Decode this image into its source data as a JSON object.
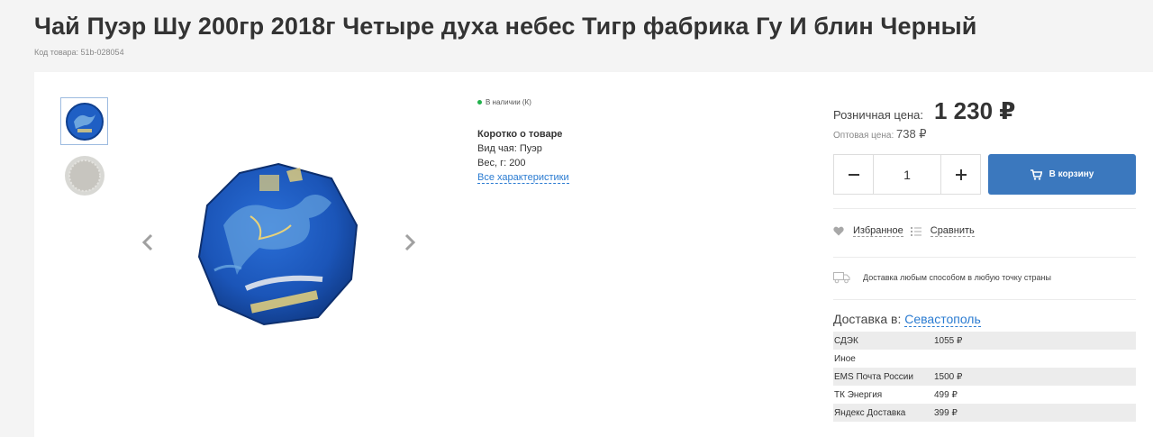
{
  "header": {
    "title": "Чай Пуэр Шу 200гр 2018г Четыре духа небес Тигр фабрика Гу И блин Черный",
    "product_code": "Код товара: 51b-028054"
  },
  "product": {
    "stock": "В наличии (К)",
    "brief_title": "Коротко о товаре",
    "tea_type": "Вид чая: Пуэр",
    "weight": "Вес, г: 200",
    "all_characteristics": "Все характеристики"
  },
  "buy": {
    "price_label": "Розничная цена:",
    "price": "1 230 ₽",
    "wholesale_label": "Оптовая цена:",
    "wholesale_price": "738 ₽",
    "quantity": "1",
    "cart_label": "В корзину",
    "favorite_label": "Избранное",
    "compare_label": "Сравнить",
    "delivery_note": "Доставка любым способом в любую точку страны",
    "delivery_to_label": "Доставка в:",
    "delivery_city": "Севастополь",
    "delivery_options": [
      {
        "name": "СДЭК",
        "price": "1055 ₽"
      },
      {
        "name": "Иное",
        "price": ""
      },
      {
        "name": "EMS Почта России",
        "price": "1500 ₽"
      },
      {
        "name": "ТК Энергия",
        "price": "499 ₽"
      },
      {
        "name": "Яндекс Доставка",
        "price": "399 ₽"
      }
    ]
  },
  "colors": {
    "accent": "#3b78be",
    "link": "#2a7bd1",
    "in_stock": "#22b14c",
    "tea_wrapper": "#1f5fc4"
  }
}
